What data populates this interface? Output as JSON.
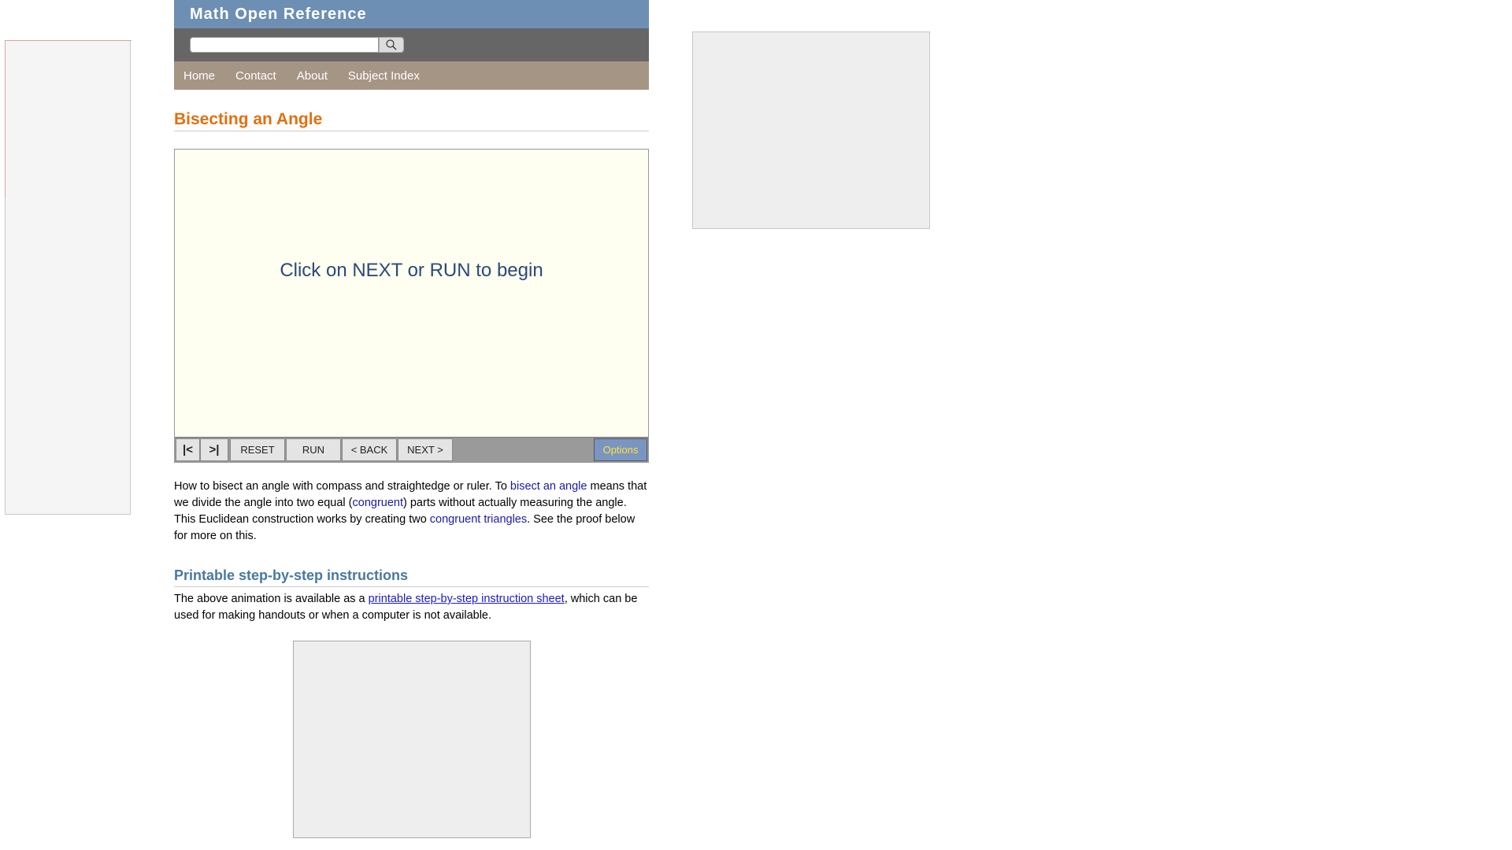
{
  "site": {
    "title": "Math Open Reference"
  },
  "search": {
    "placeholder": "",
    "value": "",
    "button_icon": "search-icon"
  },
  "nav": {
    "items": [
      "Home",
      "Contact",
      "About",
      "Subject Index"
    ]
  },
  "page": {
    "title": "Bisecting an Angle"
  },
  "applet": {
    "message": "Click on NEXT or RUN to begin",
    "controls": {
      "first": "|<",
      "last": ">|",
      "reset": "RESET",
      "run": "RUN",
      "back": "< BACK",
      "next": "NEXT >",
      "options": "Options"
    }
  },
  "intro": {
    "p1": "How to bisect an angle with compass and straightedge or ruler. To ",
    "link1": "bisect an angle",
    "p2": " means that we divide the angle into two equal (",
    "link2": "congruent",
    "p3": ") parts without actually measuring the angle. This Euclidean construction works by creating two ",
    "link3": "congruent triangles",
    "p4": ". See the proof below for more on this."
  },
  "printable": {
    "heading": "Printable step-by-step instructions",
    "p1": "The above animation is available as a ",
    "link": "printable step-by-step instruction sheet",
    "p2": ", which can be used for making handouts or when a computer is not available."
  },
  "colors": {
    "header": "#6d8fb4",
    "nav": "#a59585",
    "title": "#e07010",
    "subheading": "#4a78a0",
    "applet_bg": "#fefff0"
  }
}
